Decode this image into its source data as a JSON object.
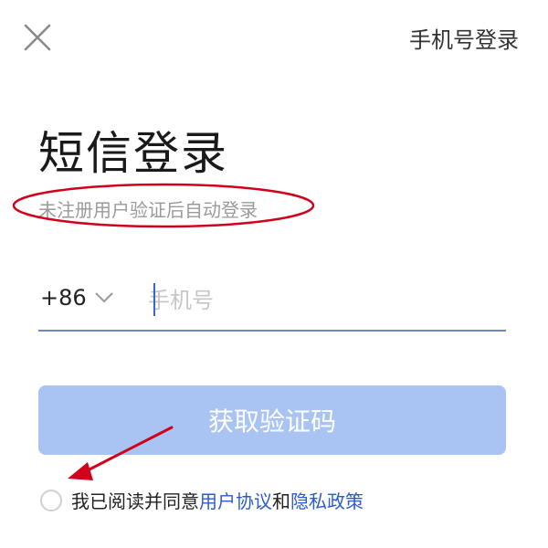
{
  "header": {
    "close_icon": "close-icon",
    "switch_login_label": "手机号登录"
  },
  "main": {
    "title": "短信登录",
    "subtitle": "未注册用户验证后自动登录",
    "country_code": "+86",
    "phone_placeholder": "手机号",
    "phone_value": "",
    "get_code_label": "获取验证码"
  },
  "agreement": {
    "prefix": "我已阅读并同意",
    "user_agreement": "用户协议",
    "and": "和",
    "privacy_policy": "隐私政策"
  },
  "colors": {
    "accent": "#2c5bd1",
    "button_disabled": "#a9c4f3",
    "annotation": "#d0021b"
  }
}
